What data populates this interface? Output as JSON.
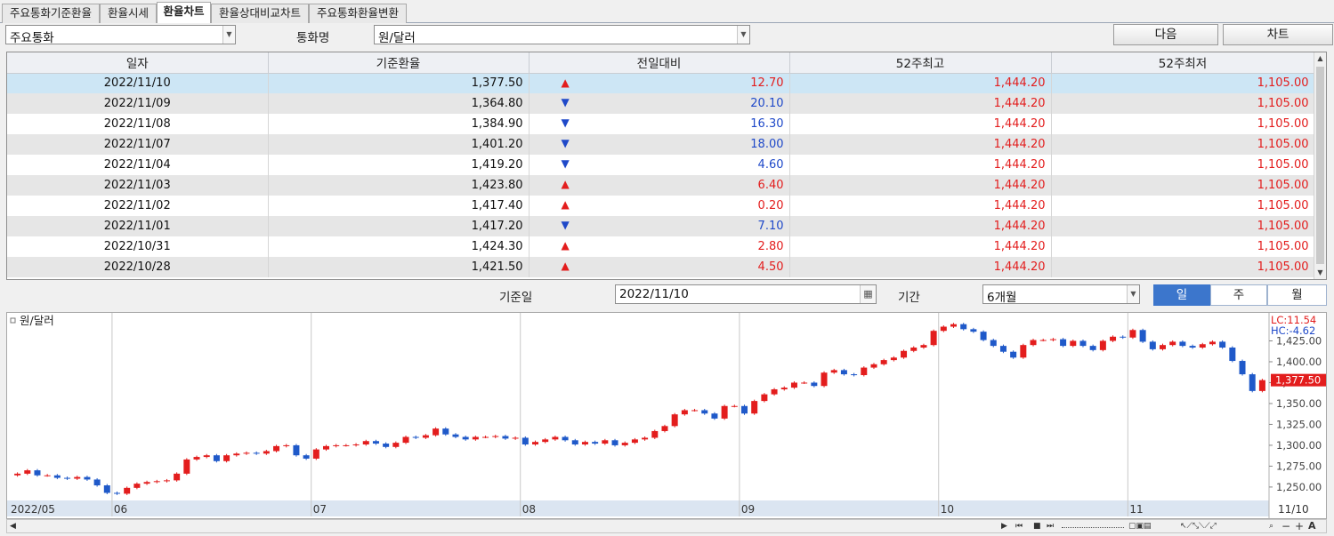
{
  "tabs": [
    {
      "label": "주요통화기준환율",
      "active": false
    },
    {
      "label": "환율시세",
      "active": false
    },
    {
      "label": "환율차트",
      "active": true
    },
    {
      "label": "환율상대비교차트",
      "active": false
    },
    {
      "label": "주요통화환율변환",
      "active": false
    }
  ],
  "controls": {
    "group_select": "주요통화",
    "currency_label": "통화명",
    "currency_select": "원/달러",
    "next_button": "다음",
    "chart_button": "차트"
  },
  "table": {
    "columns": [
      "일자",
      "기준환율",
      "전일대비",
      "52주최고",
      "52주최저"
    ],
    "rows": [
      {
        "date": "2022/11/10",
        "rate": "1,377.50",
        "dir": "up",
        "change": "12.70",
        "high": "1,444.20",
        "low": "1,105.00"
      },
      {
        "date": "2022/11/09",
        "rate": "1,364.80",
        "dir": "down",
        "change": "20.10",
        "high": "1,444.20",
        "low": "1,105.00"
      },
      {
        "date": "2022/11/08",
        "rate": "1,384.90",
        "dir": "down",
        "change": "16.30",
        "high": "1,444.20",
        "low": "1,105.00"
      },
      {
        "date": "2022/11/07",
        "rate": "1,401.20",
        "dir": "down",
        "change": "18.00",
        "high": "1,444.20",
        "low": "1,105.00"
      },
      {
        "date": "2022/11/04",
        "rate": "1,419.20",
        "dir": "down",
        "change": "4.60",
        "high": "1,444.20",
        "low": "1,105.00"
      },
      {
        "date": "2022/11/03",
        "rate": "1,423.80",
        "dir": "up",
        "change": "6.40",
        "high": "1,444.20",
        "low": "1,105.00"
      },
      {
        "date": "2022/11/02",
        "rate": "1,417.40",
        "dir": "up",
        "change": "0.20",
        "high": "1,444.20",
        "low": "1,105.00"
      },
      {
        "date": "2022/11/01",
        "rate": "1,417.20",
        "dir": "down",
        "change": "7.10",
        "high": "1,444.20",
        "low": "1,105.00"
      },
      {
        "date": "2022/10/31",
        "rate": "1,424.30",
        "dir": "up",
        "change": "2.80",
        "high": "1,444.20",
        "low": "1,105.00"
      },
      {
        "date": "2022/10/28",
        "rate": "1,421.50",
        "dir": "up",
        "change": "4.50",
        "high": "1,444.20",
        "low": "1,105.00"
      }
    ]
  },
  "filters": {
    "base_date_label": "기준일",
    "base_date": "2022/11/10",
    "period_label": "기간",
    "period_select": "6개월",
    "period_buttons": [
      {
        "label": "일",
        "active": true
      },
      {
        "label": "주",
        "active": false
      },
      {
        "label": "월",
        "active": false
      }
    ]
  },
  "colors": {
    "up": "#e31d1d",
    "down": "#1f49c9",
    "accent": "#3c76cc"
  },
  "chart_data": {
    "type": "candlestick",
    "title": "원/달러",
    "lc_label": "LC:11.54",
    "hc_label": "HC:-4.62",
    "current_label": "1,377.50",
    "ylim": [
      1235,
      1450
    ],
    "yticks": [
      1250,
      1275,
      1300,
      1325,
      1350,
      1375,
      1400,
      1425
    ],
    "ytick_labels": [
      "1,250.00",
      "1,275.00",
      "1,300.00",
      "1,325.00",
      "1,350.00",
      "1,375.00",
      "1,400.00",
      "1,425.00"
    ],
    "x_labels": [
      {
        "label": "2022/05",
        "index": 0
      },
      {
        "label": "06",
        "index": 10
      },
      {
        "label": "07",
        "index": 30
      },
      {
        "label": "08",
        "index": 51
      },
      {
        "label": "09",
        "index": 73
      },
      {
        "label": "10",
        "index": 93
      },
      {
        "label": "11",
        "index": 112
      },
      {
        "label": "11/10",
        "index": 119
      }
    ],
    "closes": [
      1266,
      1270,
      1264,
      1264,
      1261,
      1260,
      1262,
      1259,
      1252,
      1243,
      1242,
      1249,
      1254,
      1256,
      1257,
      1258,
      1266,
      1283,
      1286,
      1288,
      1281,
      1288,
      1290,
      1291,
      1290,
      1293,
      1299,
      1300,
      1288,
      1284,
      1295,
      1299,
      1300,
      1300,
      1301,
      1305,
      1302,
      1298,
      1303,
      1310,
      1309,
      1312,
      1320,
      1313,
      1310,
      1307,
      1310,
      1310,
      1311,
      1308,
      1309,
      1301,
      1304,
      1307,
      1310,
      1306,
      1301,
      1304,
      1302,
      1306,
      1300,
      1303,
      1307,
      1309,
      1317,
      1323,
      1337,
      1342,
      1342,
      1338,
      1332,
      1347,
      1347,
      1338,
      1353,
      1361,
      1367,
      1369,
      1375,
      1375,
      1371,
      1387,
      1390,
      1385,
      1384,
      1393,
      1397,
      1402,
      1405,
      1413,
      1417,
      1420,
      1437,
      1442,
      1445,
      1439,
      1436,
      1426,
      1419,
      1412,
      1405,
      1420,
      1426,
      1426,
      1427,
      1419,
      1425,
      1419,
      1414,
      1425,
      1430,
      1429,
      1438,
      1424,
      1415,
      1420,
      1424,
      1419,
      1417,
      1421,
      1424,
      1417,
      1401,
      1385,
      1365,
      1378
    ]
  }
}
